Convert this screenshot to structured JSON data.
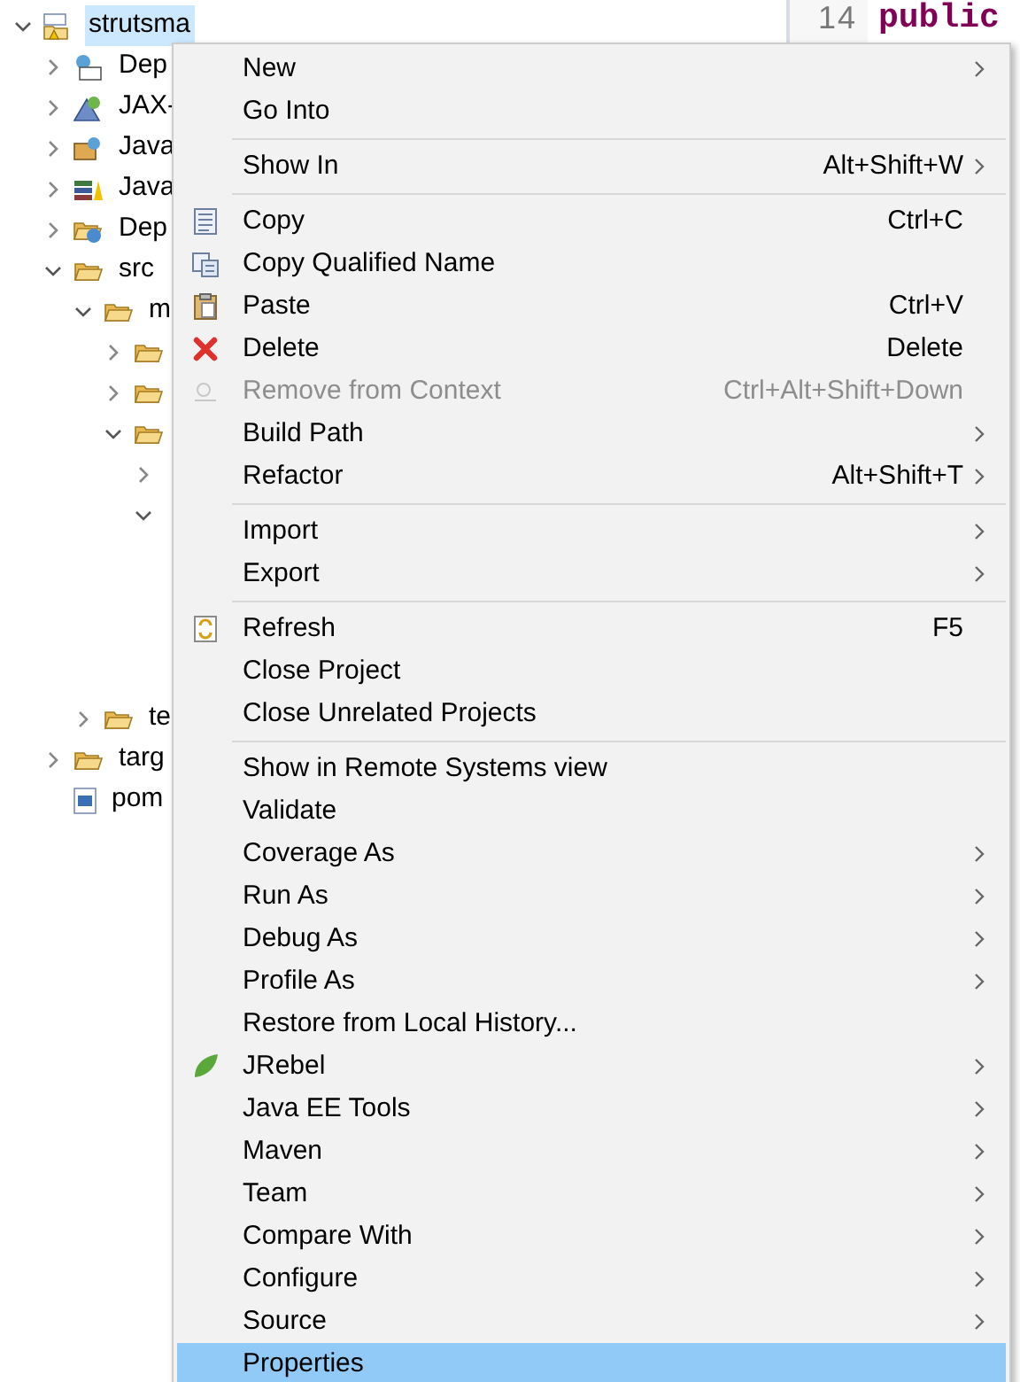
{
  "tree": {
    "items": [
      {
        "label": "strutsma",
        "kind": "project",
        "expanded": true,
        "selected": true,
        "children": [
          {
            "label": "Dep",
            "kind": "deploy",
            "expanded": false,
            "selected": false
          },
          {
            "label": "JAX-",
            "kind": "jax",
            "expanded": false,
            "selected": false
          },
          {
            "label": "Java",
            "kind": "lib",
            "expanded": false,
            "selected": false
          },
          {
            "label": "Java",
            "kind": "books",
            "expanded": false,
            "selected": false
          },
          {
            "label": "Dep",
            "kind": "folderglobe",
            "expanded": false,
            "selected": false
          },
          {
            "label": "src",
            "kind": "folder",
            "expanded": true,
            "selected": false,
            "children": [
              {
                "label": "m",
                "kind": "folder",
                "expanded": true,
                "selected": false,
                "children": [
                  {
                    "kind": "folder",
                    "expanded": false
                  },
                  {
                    "kind": "folder",
                    "expanded": false
                  },
                  {
                    "kind": "folder",
                    "expanded": true,
                    "children": [
                      {
                        "expanded": false
                      },
                      {
                        "expanded": true
                      }
                    ]
                  }
                ]
              },
              {
                "label": "te",
                "kind": "folder",
                "expanded": false,
                "selected": false
              }
            ]
          },
          {
            "label": "targ",
            "kind": "folder",
            "expanded": false,
            "selected": false
          },
          {
            "label": "pom",
            "kind": "maven",
            "selected": false
          }
        ]
      }
    ]
  },
  "editor": {
    "line_number": "14",
    "code": "public"
  },
  "context_menu": [
    {
      "kind": "item",
      "label": "New",
      "submenu": true,
      "disabled": false,
      "selected": false
    },
    {
      "kind": "item",
      "label": "Go Into",
      "submenu": false,
      "disabled": false,
      "selected": false
    },
    {
      "kind": "separator"
    },
    {
      "kind": "item",
      "label": "Show In",
      "shortcut": "Alt+Shift+W",
      "submenu": true,
      "disabled": false,
      "selected": false
    },
    {
      "kind": "separator"
    },
    {
      "kind": "copy",
      "label": "Copy",
      "shortcut": "Ctrl+C",
      "submenu": false,
      "disabled": false,
      "selected": false
    },
    {
      "kind": "copy-qualified",
      "label": "Copy Qualified Name",
      "submenu": false,
      "disabled": false,
      "selected": false
    },
    {
      "kind": "paste",
      "label": "Paste",
      "shortcut": "Ctrl+V",
      "submenu": false,
      "disabled": false,
      "selected": false
    },
    {
      "kind": "delete",
      "label": "Delete",
      "shortcut": "Delete",
      "submenu": false,
      "disabled": false,
      "selected": false
    },
    {
      "kind": "remove",
      "label": "Remove from Context",
      "shortcut": "Ctrl+Alt+Shift+Down",
      "submenu": false,
      "disabled": true,
      "selected": false
    },
    {
      "kind": "item",
      "label": "Build Path",
      "submenu": true,
      "disabled": false,
      "selected": false
    },
    {
      "kind": "item",
      "label": "Refactor",
      "shortcut": "Alt+Shift+T",
      "submenu": true,
      "disabled": false,
      "selected": false
    },
    {
      "kind": "separator"
    },
    {
      "kind": "item",
      "label": "Import",
      "submenu": true,
      "disabled": false,
      "selected": false
    },
    {
      "kind": "item",
      "label": "Export",
      "submenu": true,
      "disabled": false,
      "selected": false
    },
    {
      "kind": "separator"
    },
    {
      "kind": "refresh",
      "label": "Refresh",
      "shortcut": "F5",
      "submenu": false,
      "disabled": false,
      "selected": false
    },
    {
      "kind": "item",
      "label": "Close Project",
      "submenu": false,
      "disabled": false,
      "selected": false
    },
    {
      "kind": "item",
      "label": "Close Unrelated Projects",
      "submenu": false,
      "disabled": false,
      "selected": false
    },
    {
      "kind": "separator"
    },
    {
      "kind": "item",
      "label": "Show in Remote Systems view",
      "submenu": false,
      "disabled": false,
      "selected": false
    },
    {
      "kind": "item",
      "label": "Validate",
      "submenu": false,
      "disabled": false,
      "selected": false
    },
    {
      "kind": "item",
      "label": "Coverage As",
      "submenu": true,
      "disabled": false,
      "selected": false
    },
    {
      "kind": "item",
      "label": "Run As",
      "submenu": true,
      "disabled": false,
      "selected": false
    },
    {
      "kind": "item",
      "label": "Debug As",
      "submenu": true,
      "disabled": false,
      "selected": false
    },
    {
      "kind": "item",
      "label": "Profile As",
      "submenu": true,
      "disabled": false,
      "selected": false
    },
    {
      "kind": "item",
      "label": "Restore from Local History...",
      "submenu": false,
      "disabled": false,
      "selected": false
    },
    {
      "kind": "jrebel",
      "label": "JRebel",
      "submenu": true,
      "disabled": false,
      "selected": false
    },
    {
      "kind": "item",
      "label": "Java EE Tools",
      "submenu": true,
      "disabled": false,
      "selected": false
    },
    {
      "kind": "item",
      "label": "Maven",
      "submenu": true,
      "disabled": false,
      "selected": false
    },
    {
      "kind": "item",
      "label": "Team",
      "submenu": true,
      "disabled": false,
      "selected": false
    },
    {
      "kind": "item",
      "label": "Compare With",
      "submenu": true,
      "disabled": false,
      "selected": false
    },
    {
      "kind": "item",
      "label": "Configure",
      "submenu": true,
      "disabled": false,
      "selected": false
    },
    {
      "kind": "item",
      "label": "Source",
      "submenu": true,
      "disabled": false,
      "selected": false
    },
    {
      "kind": "item",
      "label": "Properties",
      "submenu": false,
      "disabled": false,
      "selected": true
    }
  ]
}
